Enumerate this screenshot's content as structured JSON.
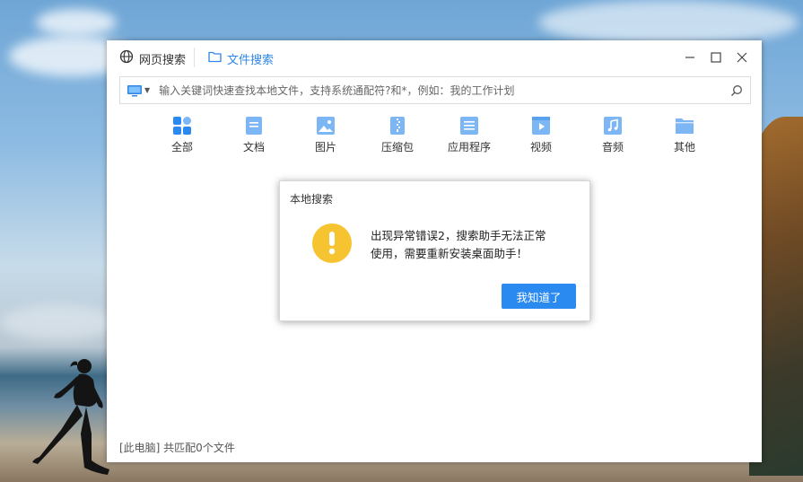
{
  "window": {
    "tabs": [
      {
        "label": "网页搜索",
        "icon": "globe-icon",
        "active": false
      },
      {
        "label": "文件搜索",
        "icon": "folder-icon",
        "active": true
      }
    ],
    "controls": [
      "minimize-icon",
      "maximize-icon",
      "close-icon"
    ]
  },
  "search": {
    "scope_icon": "computer-icon",
    "placeholder": "输入关键词快速查找本地文件，支持系统通配符?和*，例如：我的工作计划",
    "value": ""
  },
  "categories": [
    {
      "label": "全部",
      "icon": "all-icon"
    },
    {
      "label": "文档",
      "icon": "document-icon"
    },
    {
      "label": "图片",
      "icon": "image-icon"
    },
    {
      "label": "压缩包",
      "icon": "archive-icon"
    },
    {
      "label": "应用程序",
      "icon": "application-icon"
    },
    {
      "label": "视频",
      "icon": "video-icon"
    },
    {
      "label": "音频",
      "icon": "audio-icon"
    },
    {
      "label": "其他",
      "icon": "other-icon"
    }
  ],
  "status": {
    "text": "[此电脑] 共匹配0个文件"
  },
  "dialog": {
    "title": "本地搜索",
    "icon": "warning-icon",
    "message_line1": "出现异常错误2，搜索助手无法正常",
    "message_line2": "使用，需要重新安装桌面助手！",
    "ok_label": "我知道了"
  },
  "colors": {
    "accent": "#2b8af0",
    "category_icon": "#7db6f5",
    "warning": "#f7c431",
    "active_tab": "#2f86e6"
  }
}
